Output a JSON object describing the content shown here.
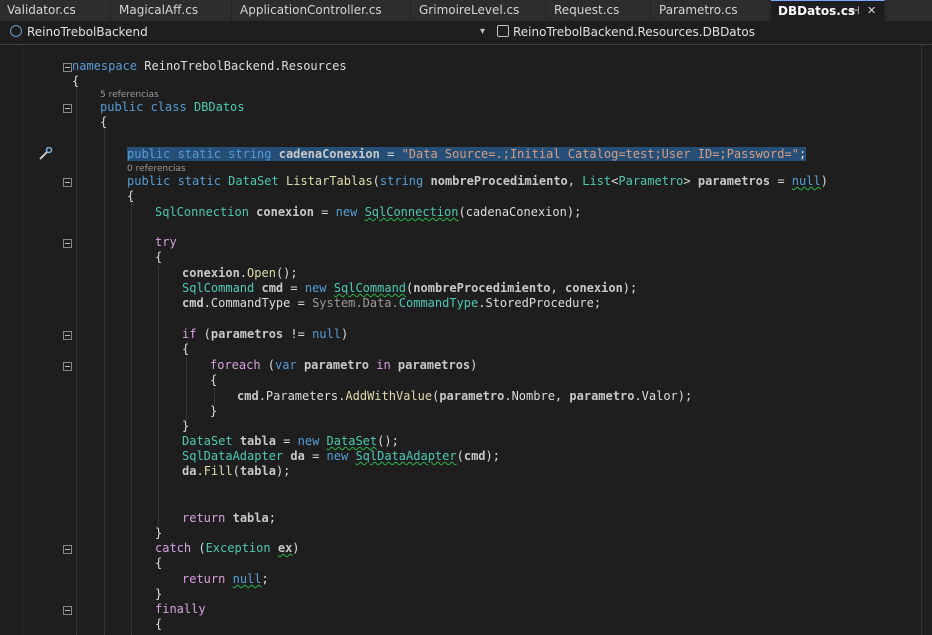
{
  "tabs": [
    {
      "label": "Validator.cs",
      "active": false
    },
    {
      "label": "MagicalAff.cs",
      "active": false
    },
    {
      "label": "ApplicationController.cs",
      "active": false
    },
    {
      "label": "GrimoireLevel.cs",
      "active": false
    },
    {
      "label": "Request.cs",
      "active": false
    },
    {
      "label": "Parametro.cs",
      "active": false
    },
    {
      "label": "DBDatos.cs",
      "active": true
    }
  ],
  "tab_controls": {
    "pin": "⊣",
    "close": "✕"
  },
  "navbar": {
    "project": "ReinoTrebolBackend",
    "type_scope": "ReinoTrebolBackend.Resources.DBDatos",
    "dropdown_glyph": "▾"
  },
  "code_lens": {
    "class_refs": "5 referencias",
    "method_refs": "0 referencias"
  },
  "code": {
    "namespace_kw": "namespace",
    "namespace_name": "ReinoTrebolBackend.Resources",
    "class_kw": "public class",
    "class_name": "DBDatos",
    "field_line": {
      "mods": "public static string",
      "name": "cadenaConexion",
      "op": " = ",
      "value": "\"Data Source=.;Initial Catalog=test;User ID=;Password=\"",
      "end": ";"
    }
  },
  "colors": {
    "background": "#1e1e1e",
    "keyword": "#569cd6",
    "type": "#4ec9b0",
    "string": "#d69d85",
    "method": "#dcdcaa",
    "control": "#d8a0df",
    "selection": "#264f78",
    "active_tab_accent": "#7aa7ff"
  },
  "icons": {
    "quick_action": "screwdriver-icon"
  }
}
